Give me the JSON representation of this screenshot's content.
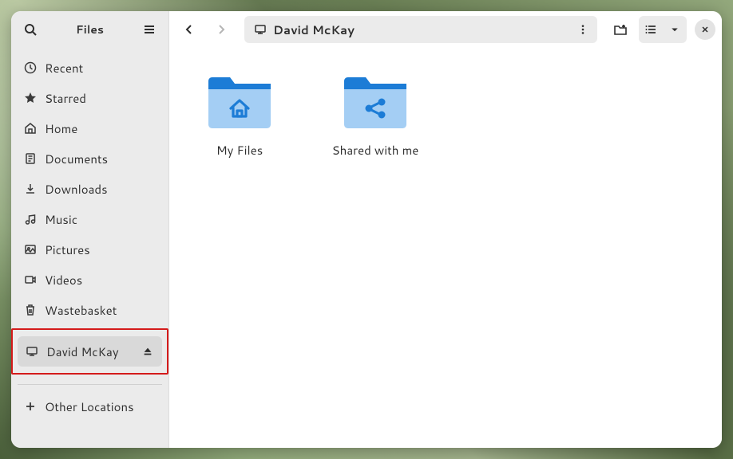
{
  "app_title": "Files",
  "pathbar": {
    "location": "David McKay"
  },
  "sidebar": {
    "items": [
      {
        "id": "recent",
        "label": "Recent"
      },
      {
        "id": "starred",
        "label": "Starred"
      },
      {
        "id": "home",
        "label": "Home"
      },
      {
        "id": "documents",
        "label": "Documents"
      },
      {
        "id": "downloads",
        "label": "Downloads"
      },
      {
        "id": "music",
        "label": "Music"
      },
      {
        "id": "pictures",
        "label": "Pictures"
      },
      {
        "id": "videos",
        "label": "Videos"
      },
      {
        "id": "trash",
        "label": "Wastebasket"
      }
    ],
    "mount": {
      "label": "David McKay"
    },
    "other": {
      "label": "Other Locations"
    }
  },
  "folders": [
    {
      "id": "myfiles",
      "label": "My Files",
      "kind": "home"
    },
    {
      "id": "shared",
      "label": "Shared with me",
      "kind": "share"
    }
  ]
}
